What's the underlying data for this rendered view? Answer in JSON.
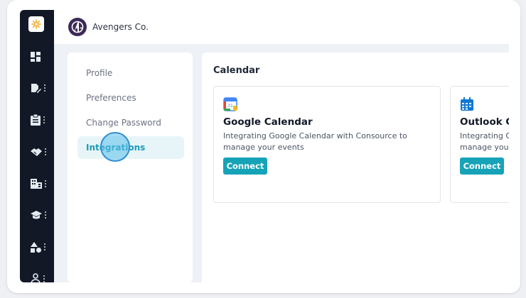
{
  "company": {
    "name": "Avengers Co."
  },
  "settings_nav": {
    "items": [
      {
        "label": "Profile",
        "active": false
      },
      {
        "label": "Preferences",
        "active": false
      },
      {
        "label": "Change Password",
        "active": false
      },
      {
        "label": "Integrations",
        "active": true
      }
    ]
  },
  "calendar": {
    "section_title": "Calendar",
    "cards": [
      {
        "icon": "google-calendar-icon",
        "title": "Google Calendar",
        "description": "Integrating Google Calendar with Consource to manage your events",
        "button_label": "Connect"
      },
      {
        "icon": "outlook-calendar-icon",
        "title": "Outlook Calendar",
        "description": "Integrating Outlook Calendar with Consource to manage your events",
        "button_label": "Connect"
      }
    ]
  },
  "sidebar_icons": [
    "dashboard-icon",
    "edit-document-icon",
    "clipboard-icon",
    "handshake-icon",
    "building-icon",
    "graduation-cap-icon",
    "shapes-icon",
    "user-icon"
  ],
  "colors": {
    "accent": "#16a3b8",
    "rail": "#121826",
    "active_bg": "#e8f5f8"
  }
}
